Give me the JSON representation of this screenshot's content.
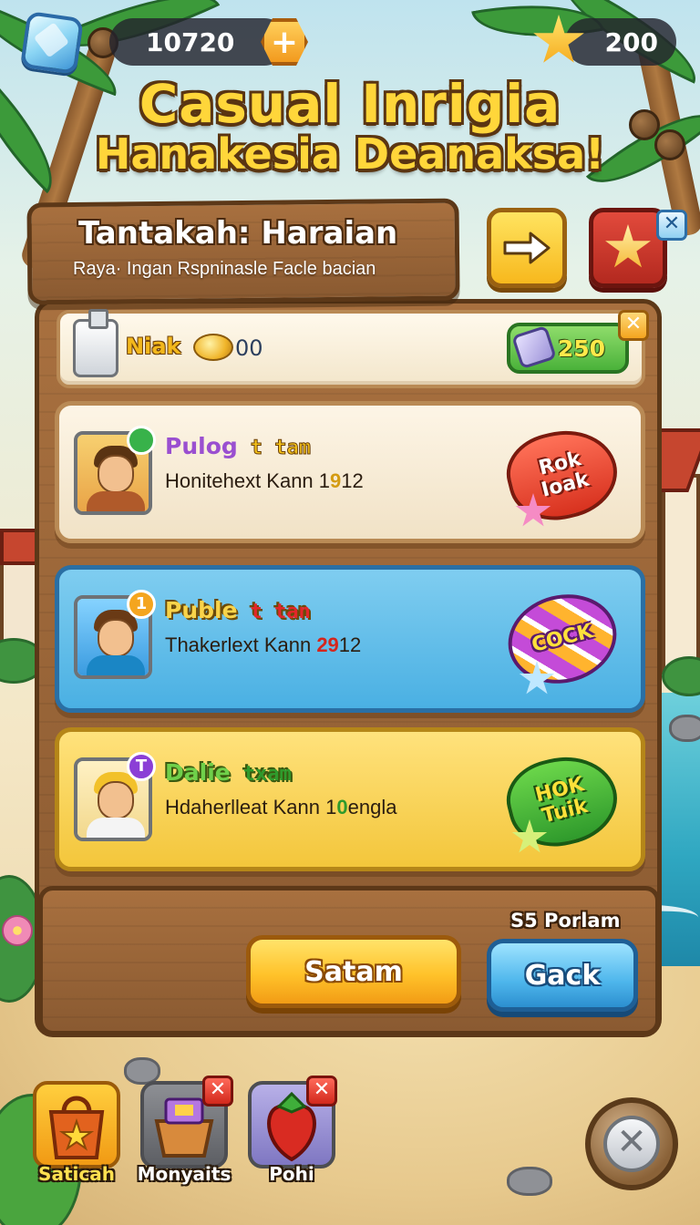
{
  "topbar": {
    "currency_primary": "10720",
    "currency_secondary": "200",
    "gem_icon": "gem-icon",
    "star_icon": "star-icon"
  },
  "title": {
    "line1": "Casual Inrigia",
    "line2": "Hanakesia Deanaksa!"
  },
  "header": {
    "title": "Tantakah: Haraian",
    "subtitle": "Raya· Ingan Rspninasle Facle bacian",
    "next_button_icon": "arrow-right-icon",
    "favorite_button_icon": "star-icon"
  },
  "reward": {
    "label": "Niak",
    "amount": "00",
    "pill_value": "250"
  },
  "cards": [
    {
      "name": "Pulog",
      "tag": "t tam",
      "desc_prefix": "Honitehext Kann 1",
      "desc_highlight": "9",
      "desc_suffix": "12",
      "badge": "",
      "sticker": "Rok\nIoak",
      "colors": {
        "name": "#9a4fd0",
        "tag": "#f4c21a",
        "badge": "#38b24a"
      }
    },
    {
      "name": "Puble",
      "tag": "t tan",
      "desc_prefix": "Thakerlext Kann ",
      "desc_highlight": "29",
      "desc_suffix": "12",
      "badge": "1",
      "sticker": "COCK",
      "colors": {
        "name": "#f8d34a",
        "tag": "#e2262a",
        "badge": "#f4a51f"
      }
    },
    {
      "name": "Dalie",
      "tag": "txam",
      "desc_prefix": "Hdaherlleat Kann 1",
      "desc_highlight": "0",
      "desc_suffix": "engla",
      "badge": "T",
      "sticker": "HOK\nTuik",
      "colors": {
        "name": "#6fd04a",
        "tag": "#2f9a2c",
        "badge": "#8b3fd6"
      }
    }
  ],
  "footer": {
    "timer": "S5 Porlam",
    "primary_button": "Satam",
    "secondary_button": "Gack"
  },
  "dock": [
    {
      "label": "Saticah",
      "icon": "shopping-bag-icon",
      "active": true
    },
    {
      "label": "Monyaits",
      "icon": "gift-basket-icon",
      "active": false
    },
    {
      "label": "Pohi",
      "icon": "strawberry-icon",
      "active": false
    }
  ],
  "close_icon": "✕",
  "colors": {
    "accent_yellow": "#ffc22a",
    "accent_blue": "#4eb6ec",
    "wood": "#8a5a31"
  }
}
